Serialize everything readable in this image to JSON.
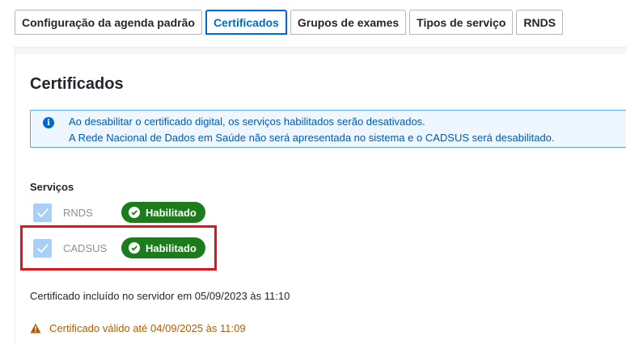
{
  "tabs": [
    {
      "label": "Configuração da agenda padrão",
      "active": false
    },
    {
      "label": "Certificados",
      "active": true
    },
    {
      "label": "Grupos de exames",
      "active": false
    },
    {
      "label": "Tipos de serviço",
      "active": false
    },
    {
      "label": "RNDS",
      "active": false
    }
  ],
  "page": {
    "title": "Certificados"
  },
  "alert": {
    "icon": "info-icon",
    "line1": "Ao desabilitar o certificado digital, os serviços habilitados serão desativados.",
    "line2": "A Rede Nacional de Dados em Saúde não será apresentada no sistema e o CADSUS será desabilitado."
  },
  "services": {
    "label": "Serviços",
    "items": [
      {
        "name": "RNDS",
        "checked": true,
        "status": "Habilitado"
      },
      {
        "name": "CADSUS",
        "checked": true,
        "status": "Habilitado"
      }
    ]
  },
  "certificate": {
    "included": "Certificado incluído no servidor em 05/09/2023 às 11:10",
    "valid_until": "Certificado válido até 04/09/2025 às 11:09"
  },
  "colors": {
    "accent": "#0069d0",
    "success": "#1c7c1b",
    "warning": "#b85b00",
    "highlight": "#e2141b"
  }
}
